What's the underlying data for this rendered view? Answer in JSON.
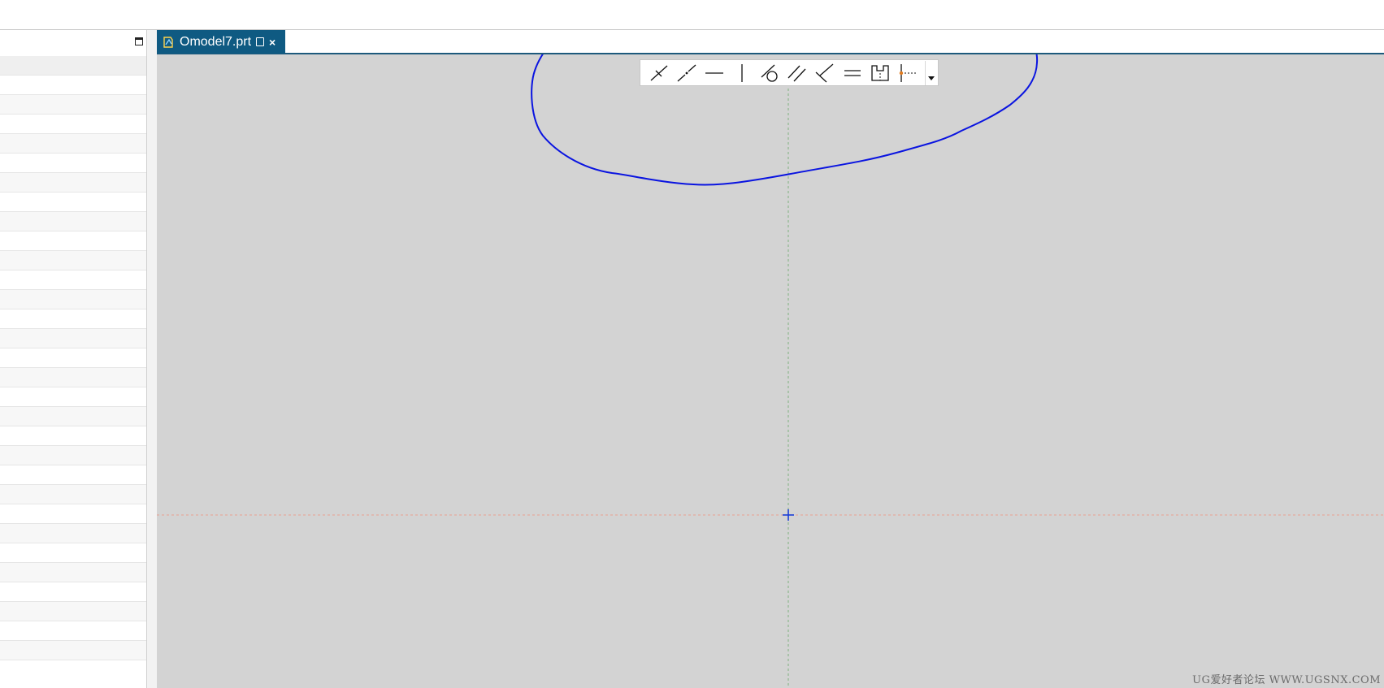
{
  "document_tab": {
    "title": "Omodel7.prt",
    "close_glyph": "×",
    "icon": "part-file-icon",
    "active_color": "#0f5a82"
  },
  "left_panel": {
    "maximize_icon": "maximize-icon",
    "rows": 31
  },
  "sketch_constraints_toolbar": {
    "tools": [
      "coincident-icon",
      "point-on-curve-icon",
      "horizontal-icon",
      "vertical-icon",
      "tangent-icon",
      "parallel-icon",
      "perpendicular-icon",
      "equal-length-icon",
      "midpoint-icon",
      "point-on-string-icon"
    ],
    "more_icon": "dropdown-arrow-icon"
  },
  "viewport": {
    "background": "#d3d3d3",
    "horizontal_axis_color": "#e8a090",
    "vertical_axis_color": "#7fb07f",
    "origin_marker_color": "#1a3dd6",
    "annotation_color": "#0a14e0"
  },
  "watermark": "UG爱好者论坛 WWW.UGSNX.COM"
}
